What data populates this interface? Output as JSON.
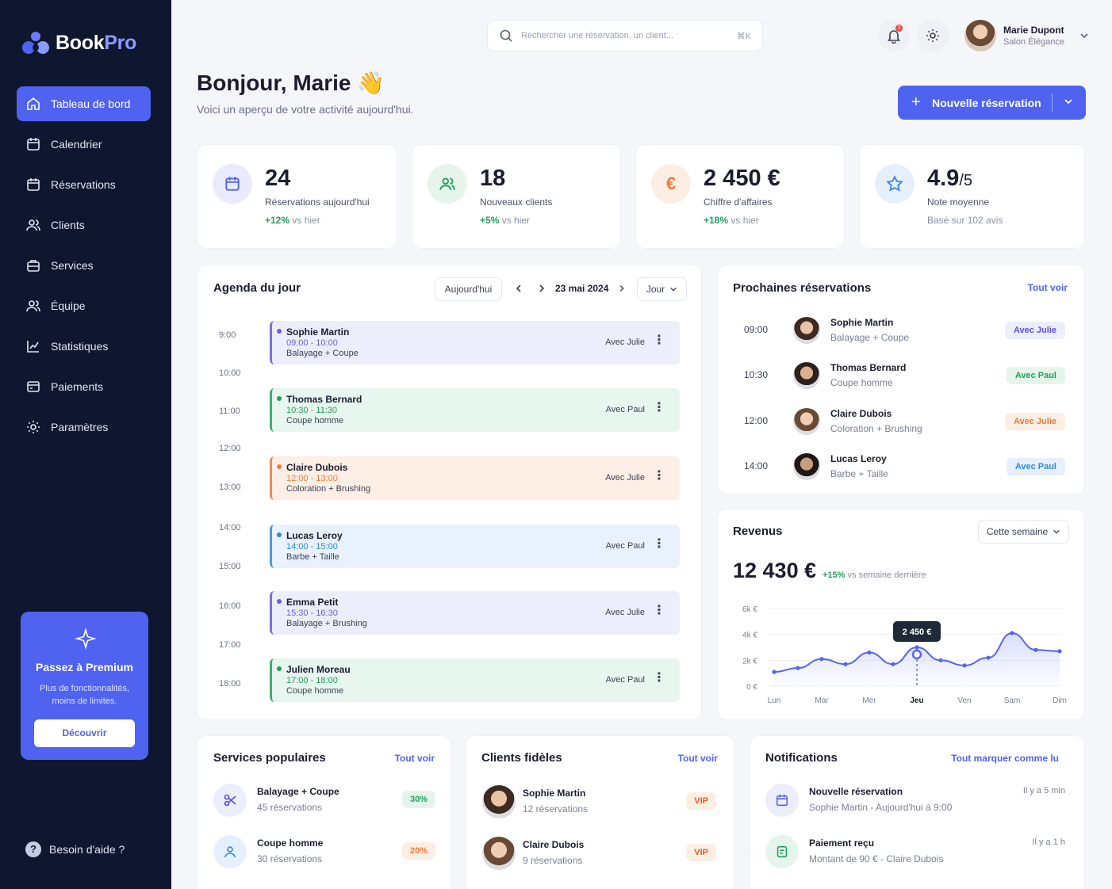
{
  "app": {
    "name_main": "Book",
    "name_accent": "Pro"
  },
  "sidebar": {
    "items": [
      {
        "label": "Tableau de bord",
        "icon": "home-icon",
        "active": true
      },
      {
        "label": "Calendrier",
        "icon": "calendar-icon"
      },
      {
        "label": "Réservations",
        "icon": "calendar-check-icon"
      },
      {
        "label": "Clients",
        "icon": "users-icon"
      },
      {
        "label": "Services",
        "icon": "briefcase-icon"
      },
      {
        "label": "Équipe",
        "icon": "team-icon"
      },
      {
        "label": "Statistiques",
        "icon": "chart-icon"
      },
      {
        "label": "Paiements",
        "icon": "credit-card-icon"
      },
      {
        "label": "Paramètres",
        "icon": "gear-icon"
      }
    ],
    "premium": {
      "title": "Passez à Premium",
      "desc": "Plus de fonctionnalités, moins de limites.",
      "button": "Découvrir"
    },
    "help": "Besoin d'aide ?"
  },
  "topbar": {
    "search_placeholder": "Rechercher une réservation, un client...",
    "search_shortcut": "⌘K",
    "notif_count": "3",
    "user": {
      "name": "Marie Dupont",
      "salon": "Salon Élégance"
    }
  },
  "header": {
    "greeting": "Bonjour, Marie 👋",
    "subtitle": "Voici un aperçu de votre activité aujourd'hui.",
    "new_button": "Nouvelle réservation"
  },
  "stats": [
    {
      "value": "24",
      "suffix": "",
      "label": "Réservations aujourd'hui",
      "trend": "+12%",
      "trend_text": "vs hier",
      "icon": "calendar-icon"
    },
    {
      "value": "18",
      "suffix": "",
      "label": "Nouveaux clients",
      "trend": "+5%",
      "trend_text": "vs hier",
      "icon": "users-icon"
    },
    {
      "value": "2 450 €",
      "suffix": "",
      "label": "Chiffre d'affaires",
      "trend": "+18%",
      "trend_text": "vs hier",
      "icon": "euro-icon"
    },
    {
      "value": "4.9",
      "suffix": "/5",
      "label": "Note moyenne",
      "trend": "",
      "trend_text": "Basé sur 102 avis",
      "icon": "star-icon"
    }
  ],
  "agenda": {
    "title": "Agenda du jour",
    "today_button": "Aujourd'hui",
    "date": "23 mai 2024",
    "view": "Jour",
    "hours": [
      "9:00",
      "10:00",
      "11:00",
      "12:00",
      "13:00",
      "14:00",
      "15:00",
      "16:00",
      "17:00",
      "18:00"
    ],
    "events": [
      {
        "name": "Sophie Martin",
        "time": "09:00 - 10:00",
        "service": "Balayage + Coupe",
        "with": "Avec Julie"
      },
      {
        "name": "Thomas Bernard",
        "time": "10:30 - 11:30",
        "service": "Coupe homme",
        "with": "Avec Paul"
      },
      {
        "name": "Claire Dubois",
        "time": "12:00 - 13:00",
        "service": "Coloration + Brushing",
        "with": "Avec Julie"
      },
      {
        "name": "Lucas Leroy",
        "time": "14:00 - 15:00",
        "service": "Barbe + Taille",
        "with": "Avec Paul"
      },
      {
        "name": "Emma Petit",
        "time": "15:30 - 16:30",
        "service": "Balayage + Brushing",
        "with": "Avec Julie"
      },
      {
        "name": "Julien Moreau",
        "time": "17:00 - 18:00",
        "service": "Coupe homme",
        "with": "Avec Paul"
      }
    ]
  },
  "upcoming": {
    "title": "Prochaines réservations",
    "link": "Tout voir",
    "items": [
      {
        "time": "09:00",
        "name": "Sophie Martin",
        "service": "Balayage + Coupe",
        "tag": "Avec Julie"
      },
      {
        "time": "10:30",
        "name": "Thomas Bernard",
        "service": "Coupe homme",
        "tag": "Avec Paul"
      },
      {
        "time": "12:00",
        "name": "Claire Dubois",
        "service": "Coloration + Brushing",
        "tag": "Avec Julie"
      },
      {
        "time": "14:00",
        "name": "Lucas Leroy",
        "service": "Barbe + Taille",
        "tag": "Avec Paul"
      }
    ]
  },
  "revenue": {
    "title": "Revenus",
    "period": "Cette semaine",
    "total": "12 430 €",
    "trend": "+15%",
    "trend_text": "vs semaine dernière",
    "tooltip": "2 450 €"
  },
  "chart_data": {
    "type": "line",
    "categories": [
      "Lun",
      "Mar",
      "Mer",
      "Jeu",
      "Ven",
      "Sam",
      "Dim"
    ],
    "x": [
      0,
      0.5,
      1,
      1.5,
      2,
      2.5,
      3,
      3.5,
      4,
      4.5,
      5,
      5.5,
      6
    ],
    "values": [
      1100,
      1400,
      2100,
      1700,
      2600,
      1700,
      3000,
      2000,
      1600,
      2200,
      4100,
      2800,
      2700
    ],
    "highlight": {
      "category": "Jeu",
      "value": 2450
    },
    "yticks": [
      "0 €",
      "2k €",
      "4k €",
      "6k €"
    ],
    "ylim": [
      0,
      6000
    ],
    "title": "",
    "xlabel": "",
    "ylabel": ""
  },
  "popular_services": {
    "title": "Services populaires",
    "link": "Tout voir",
    "items": [
      {
        "name": "Balayage + Coupe",
        "count": "45 réservations",
        "pct": "30%"
      },
      {
        "name": "Coupe homme",
        "count": "30 réservations",
        "pct": "20%"
      }
    ]
  },
  "loyal_clients": {
    "title": "Clients fidèles",
    "link": "Tout voir",
    "items": [
      {
        "name": "Sophie Martin",
        "count": "12 réservations",
        "tag": "VIP"
      },
      {
        "name": "Claire Dubois",
        "count": "9 réservations",
        "tag": "VIP"
      }
    ]
  },
  "notifications": {
    "title": "Notifications",
    "link": "Tout marquer comme lu",
    "items": [
      {
        "title": "Nouvelle réservation",
        "desc": "Sophie Martin - Aujourd'hui à 9:00",
        "time": "Il y a 5 min"
      },
      {
        "title": "Paiement reçu",
        "desc": "Montant de 90 € - Claire Dubois",
        "time": "Il y a 1 h"
      }
    ]
  },
  "colors": {
    "accent": "#4f63f0",
    "sidebar": "#0f1730",
    "success": "#22a05a",
    "orange": "#f07a3a"
  }
}
